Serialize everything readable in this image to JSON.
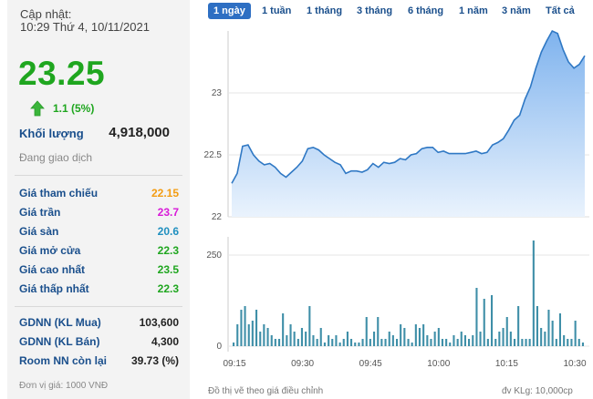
{
  "info": {
    "update_label": "Cập nhật:",
    "update_time": "10:29 Thứ 4, 10/11/2021",
    "price": "23.25",
    "change": "1.1 (5%)",
    "volume_label": "Khối lượng",
    "volume_value": "4,918,000",
    "status": "Đang giao dịch",
    "unit": "Đơn vị giá: 1000 VNĐ"
  },
  "prices": [
    {
      "label": "Giá tham chiếu",
      "value": "22.15",
      "color": "#f39c12"
    },
    {
      "label": "Giá trần",
      "value": "23.7",
      "color": "#d81ad8"
    },
    {
      "label": "Giá sàn",
      "value": "20.6",
      "color": "#1f8fbf"
    },
    {
      "label": "Giá mở cửa",
      "value": "22.3",
      "color": "#1fa61f"
    },
    {
      "label": "Giá cao nhất",
      "value": "23.5",
      "color": "#1fa61f"
    },
    {
      "label": "Giá thấp nhất",
      "value": "22.3",
      "color": "#1fa61f"
    }
  ],
  "foreign": [
    {
      "label": "GDNN (KL Mua)",
      "value": "103,600"
    },
    {
      "label": "GDNN (KL Bán)",
      "value": "4,300"
    },
    {
      "label": "Room NN còn lại",
      "value": "39.73 (%)"
    }
  ],
  "tabs": [
    "1 ngày",
    "1 tuần",
    "1 tháng",
    "3 tháng",
    "6 tháng",
    "1 năm",
    "3 năm",
    "Tất cả"
  ],
  "active_tab": 0,
  "colors": {
    "up": "#1fa61f",
    "line": "#2f78c4",
    "area_top": "#7fb3ee",
    "area_bottom": "#eaf3fd",
    "bar": "#3f8fa8",
    "active_tab": "#2e6fc3"
  },
  "chart_data": {
    "type": "line",
    "price_ticks": [
      "23",
      "22.5",
      "22"
    ],
    "volume_ticks": [
      "250",
      "0"
    ],
    "time_ticks": [
      "09:15",
      "09:30",
      "09:45",
      "10:00",
      "10:15",
      "10:30"
    ],
    "price_range": [
      22,
      23.5
    ],
    "price_series": [
      22.27,
      22.35,
      22.57,
      22.58,
      22.5,
      22.45,
      22.42,
      22.43,
      22.4,
      22.35,
      22.32,
      22.36,
      22.4,
      22.45,
      22.55,
      22.56,
      22.54,
      22.5,
      22.47,
      22.44,
      22.42,
      22.35,
      22.37,
      22.37,
      22.36,
      22.38,
      22.43,
      22.4,
      22.44,
      22.43,
      22.44,
      22.47,
      22.46,
      22.5,
      22.51,
      22.55,
      22.56,
      22.56,
      22.52,
      22.53,
      22.51,
      22.51,
      22.51,
      22.51,
      22.52,
      22.53,
      22.51,
      22.52,
      22.58,
      22.6,
      22.63,
      22.7,
      22.78,
      22.82,
      22.95,
      23.05,
      23.2,
      23.33,
      23.42,
      23.5,
      23.48,
      23.35,
      23.25,
      23.2,
      23.23,
      23.3
    ],
    "volume_range": [
      0,
      300
    ],
    "volume_series": [
      10,
      60,
      100,
      110,
      60,
      70,
      100,
      40,
      60,
      50,
      30,
      20,
      20,
      90,
      30,
      60,
      40,
      20,
      50,
      40,
      110,
      30,
      20,
      50,
      10,
      30,
      20,
      30,
      10,
      20,
      40,
      20,
      10,
      10,
      20,
      80,
      20,
      40,
      80,
      20,
      20,
      40,
      30,
      20,
      60,
      50,
      20,
      10,
      60,
      50,
      60,
      30,
      20,
      40,
      50,
      20,
      20,
      10,
      30,
      20,
      40,
      30,
      20,
      30,
      160,
      40,
      130,
      20,
      140,
      20,
      40,
      50,
      80,
      40,
      20,
      110,
      20,
      20,
      20,
      290,
      110,
      50,
      40,
      100,
      70,
      20,
      90,
      30,
      20,
      20,
      70,
      20,
      10
    ],
    "note_left": "Đồ thị vẽ theo giá điều chỉnh",
    "note_right": "đv KLg: 10,000cp"
  }
}
